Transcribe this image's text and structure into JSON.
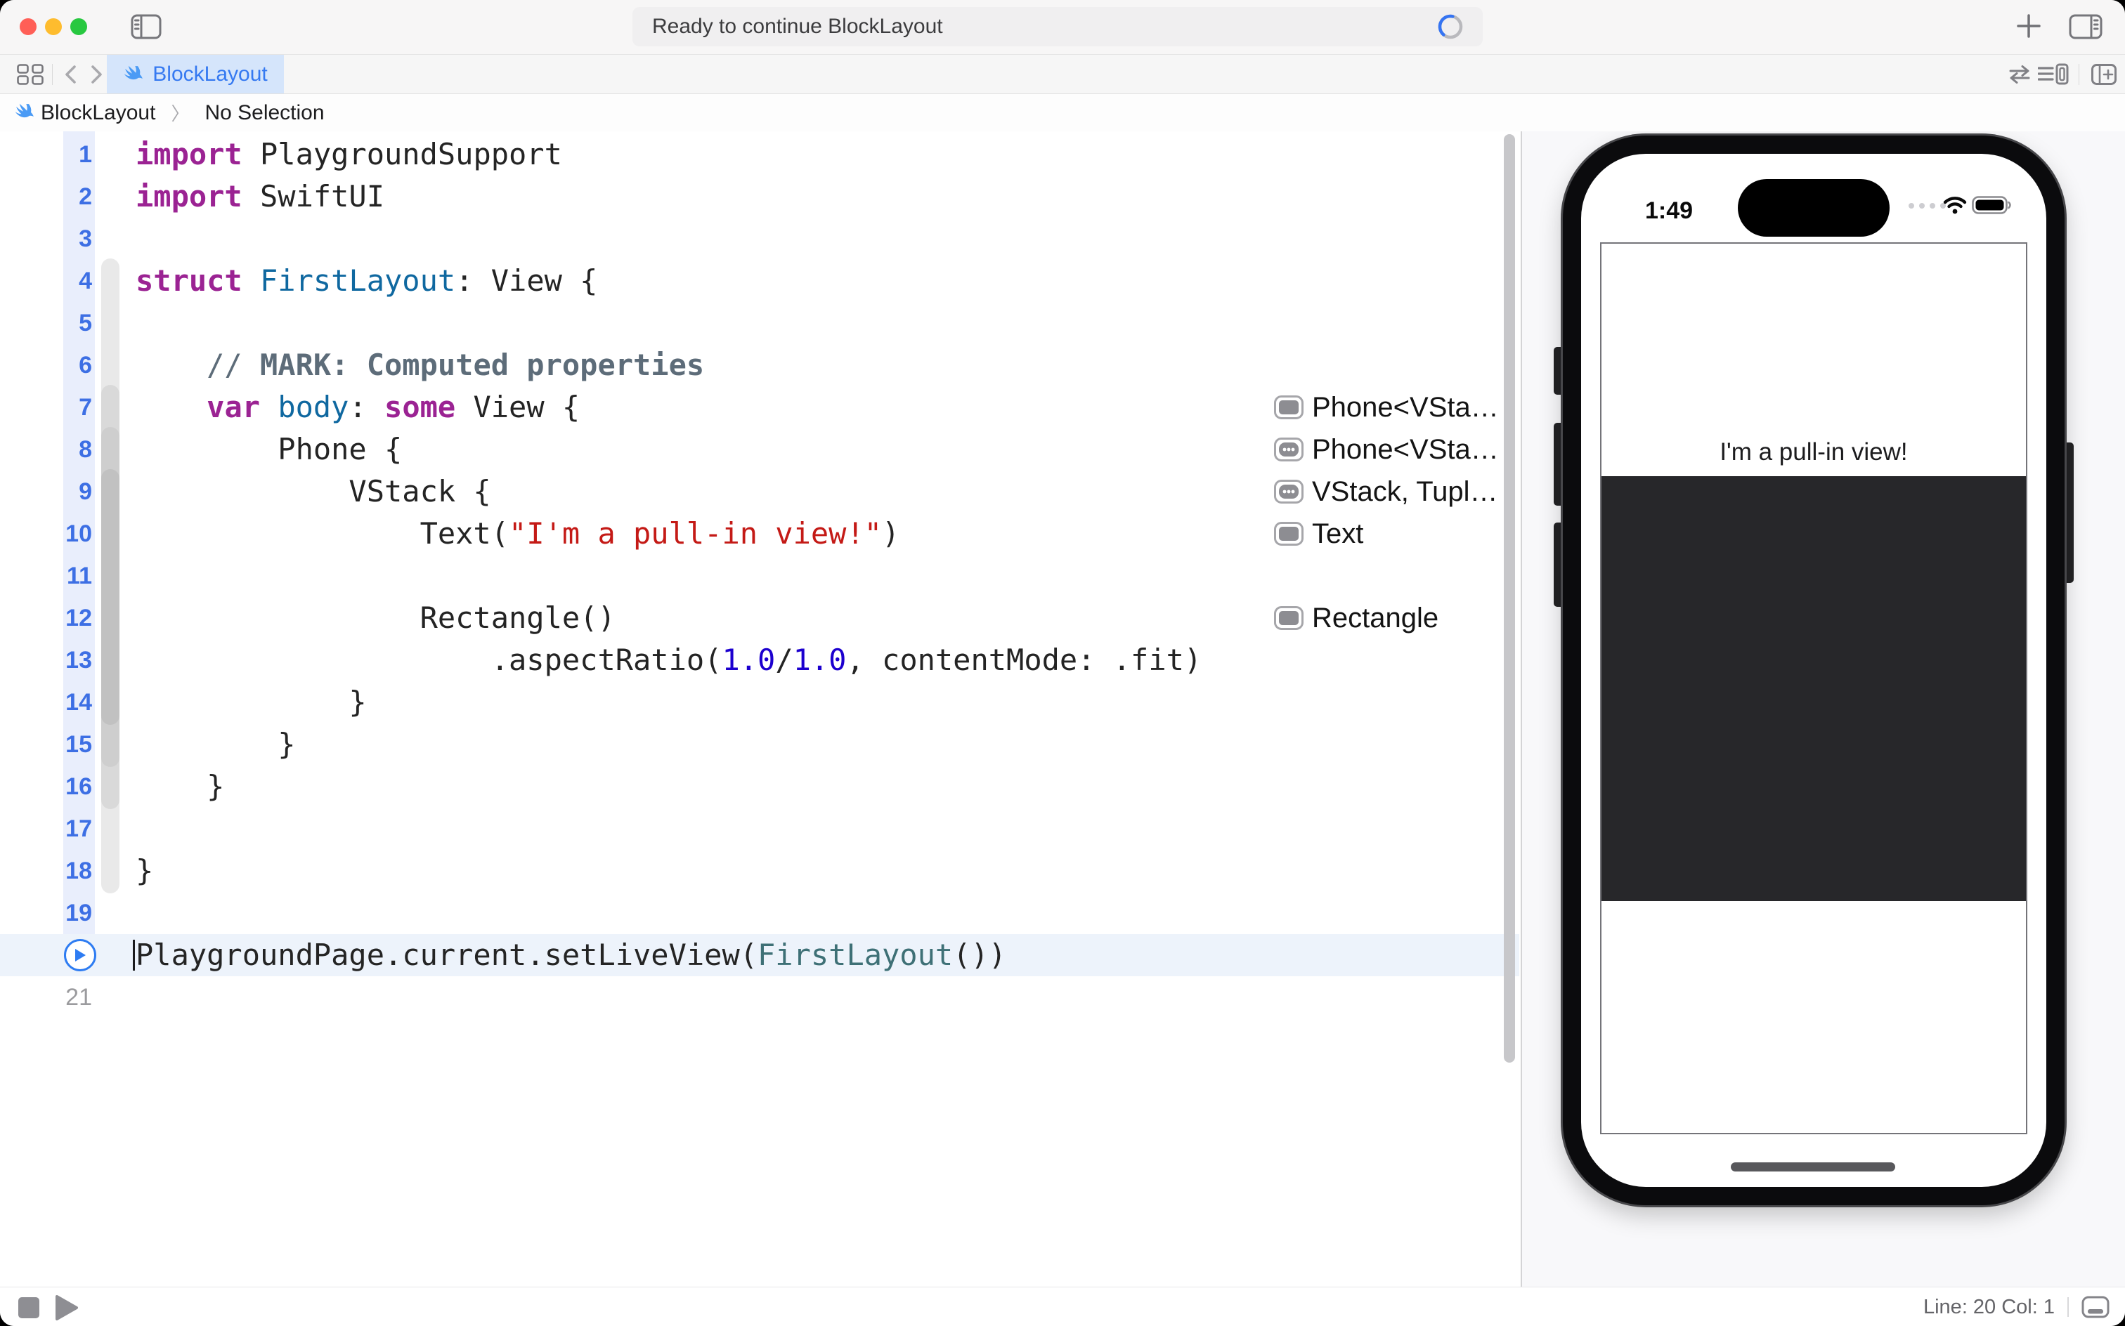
{
  "titlebar": {
    "status_text": "Ready to continue BlockLayout"
  },
  "tabbar": {
    "tab_label": "BlockLayout"
  },
  "jumpbar": {
    "file": "BlockLayout",
    "separator": "〉",
    "selection": "No Selection"
  },
  "editor": {
    "font": "monospace-code",
    "active_line": 20,
    "last_line_number": 21,
    "lines": [
      {
        "n": 1,
        "tokens": [
          [
            "kw",
            "import"
          ],
          [
            "pl",
            " PlaygroundSupport"
          ]
        ]
      },
      {
        "n": 2,
        "tokens": [
          [
            "kw",
            "import"
          ],
          [
            "pl",
            " SwiftUI"
          ]
        ]
      },
      {
        "n": 3,
        "tokens": []
      },
      {
        "n": 4,
        "tokens": [
          [
            "kw",
            "struct"
          ],
          [
            "pl",
            " "
          ],
          [
            "decl",
            "FirstLayout"
          ],
          [
            "pl",
            ": View {"
          ]
        ]
      },
      {
        "n": 5,
        "tokens": []
      },
      {
        "n": 6,
        "tokens": [
          [
            "cmt",
            "    // "
          ],
          [
            "cmtb",
            "MARK: Computed properties"
          ]
        ]
      },
      {
        "n": 7,
        "tokens": [
          [
            "pl",
            "    "
          ],
          [
            "kw",
            "var"
          ],
          [
            "pl",
            " "
          ],
          [
            "decl",
            "body"
          ],
          [
            "pl",
            ": "
          ],
          [
            "kw",
            "some"
          ],
          [
            "pl",
            " View {"
          ]
        ]
      },
      {
        "n": 8,
        "tokens": [
          [
            "pl",
            "        Phone {"
          ]
        ]
      },
      {
        "n": 9,
        "tokens": [
          [
            "pl",
            "            VStack {"
          ]
        ]
      },
      {
        "n": 10,
        "tokens": [
          [
            "pl",
            "                Text("
          ],
          [
            "str",
            "\"I'm a pull-in view!\""
          ],
          [
            "pl",
            ")"
          ]
        ]
      },
      {
        "n": 11,
        "tokens": []
      },
      {
        "n": 12,
        "tokens": [
          [
            "pl",
            "                Rectangle()"
          ]
        ]
      },
      {
        "n": 13,
        "tokens": [
          [
            "pl",
            "                    .aspectRatio("
          ],
          [
            "num",
            "1.0"
          ],
          [
            "pl",
            "/"
          ],
          [
            "num",
            "1.0"
          ],
          [
            "pl",
            ", contentMode: .fit)"
          ]
        ]
      },
      {
        "n": 14,
        "tokens": [
          [
            "pl",
            "            }"
          ]
        ]
      },
      {
        "n": 15,
        "tokens": [
          [
            "pl",
            "        }"
          ]
        ]
      },
      {
        "n": 16,
        "tokens": [
          [
            "pl",
            "    }"
          ]
        ]
      },
      {
        "n": 17,
        "tokens": []
      },
      {
        "n": 18,
        "tokens": [
          [
            "pl",
            "}"
          ]
        ]
      },
      {
        "n": 19,
        "tokens": []
      },
      {
        "n": 20,
        "tokens": [
          [
            "pl",
            "PlaygroundPage.current.setLiveView("
          ],
          [
            "tref",
            "FirstLayout"
          ],
          [
            "pl",
            "())"
          ]
        ],
        "highlighted": true
      },
      {
        "n": 21,
        "tokens": [],
        "muted": true
      }
    ]
  },
  "results": [
    {
      "label": "Phone<VSta…",
      "icon": "result-plain-icon",
      "line": 7
    },
    {
      "label": "Phone<VSta…",
      "icon": "result-dots-icon",
      "line": 8
    },
    {
      "label": "VStack, Tupl…",
      "icon": "result-dots-icon",
      "line": 9
    },
    {
      "label": "Text",
      "icon": "result-plain-icon",
      "line": 10
    },
    {
      "label": "Rectangle",
      "icon": "result-plain-icon",
      "line": 12
    }
  ],
  "preview": {
    "time": "1:49",
    "live_text": "I'm a pull-in view!"
  },
  "statusbar": {
    "line_col": "Line: 20  Col: 1"
  },
  "colors": {
    "accent_blue": "#3574f2",
    "tab_active_bg": "#d5e5fb",
    "tab_label_blue": "#3579f1",
    "line_number_blue": "#3d6fe4",
    "keyword": "#9b2393",
    "declaration": "#0f68a0",
    "string_red": "#c41a16",
    "number_blue": "#1c00cf",
    "comment_gray": "#5d6c79",
    "type_ref_teal": "#3e7076",
    "highlight_line_bg": "#edf3fb",
    "live_rectangle": "#27272a",
    "traffic_close": "#ff5f57",
    "traffic_min": "#febc2e",
    "traffic_zoom": "#28c840"
  }
}
